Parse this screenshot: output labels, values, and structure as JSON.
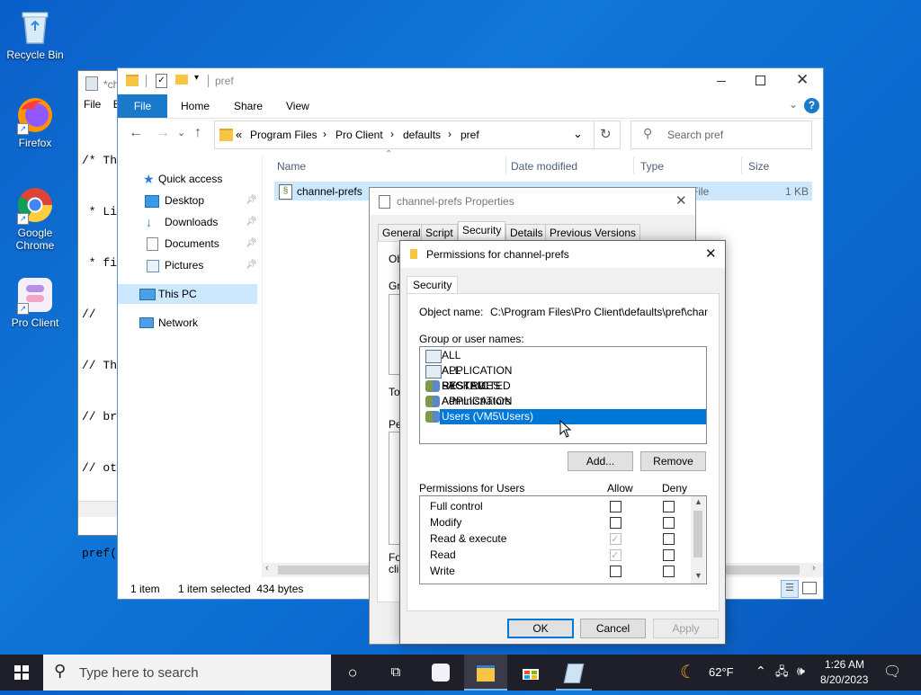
{
  "desktop": {
    "icons": [
      {
        "label": "Recycle Bin"
      },
      {
        "label": "Firefox"
      },
      {
        "label": "Google Chrome"
      },
      {
        "label": "Pro Client"
      }
    ]
  },
  "notepad": {
    "title_fragment": "*ch",
    "menu_file": "File",
    "menu_edit": "E",
    "code_lines": [
      "/* Th",
      " * Li",
      " * fi",
      "//",
      "// Th",
      "// br",
      "// ot",
      "",
      "pref("
    ]
  },
  "explorer": {
    "title": "pref",
    "ribbon": {
      "file": "File",
      "home": "Home",
      "share": "Share",
      "view": "View"
    },
    "address": {
      "sep": "«",
      "parts": [
        "Program Files",
        "Pro Client",
        "defaults",
        "pref"
      ]
    },
    "search_placeholder": "Search pref",
    "nav": {
      "quick_access": "Quick access",
      "desktop": "Desktop",
      "downloads": "Downloads",
      "documents": "Documents",
      "pictures": "Pictures",
      "this_pc": "This PC",
      "network": "Network"
    },
    "columns": {
      "name": "Name",
      "date": "Date modified",
      "type": "Type",
      "size": "Size"
    },
    "files": [
      {
        "name": "channel-prefs",
        "type_fragment": "File",
        "size": "1 KB"
      }
    ],
    "status": {
      "count": "1 item",
      "selected": "1 item selected  434 bytes"
    }
  },
  "properties": {
    "title": "channel-prefs Properties",
    "tabs": [
      "General",
      "Script",
      "Security",
      "Details",
      "Previous Versions"
    ],
    "fragments": {
      "ob": "Ob",
      "gr": "Gr",
      "to": "To",
      "pe": "Pe",
      "fo": "Fo",
      "cli": "clic"
    }
  },
  "permissions": {
    "title": "Permissions for channel-prefs",
    "tab": "Security",
    "object_label": "Object name:",
    "object_value": "C:\\Program Files\\Pro Client\\defaults\\pref\\channel-p",
    "group_label": "Group or user names:",
    "groups": [
      {
        "name": "ALL APPLICATION PACKAGES"
      },
      {
        "name": "ALL RESTRICTED APPLICATION PACKAGES"
      },
      {
        "name": "SYSTEM"
      },
      {
        "name": "Administrators (VM5\\Administrators)"
      },
      {
        "name": "Users (VM5\\Users)"
      }
    ],
    "add_button": "Add...",
    "remove_button": "Remove",
    "perm_for": "Permissions for Users",
    "allow_header": "Allow",
    "deny_header": "Deny",
    "perms": [
      {
        "name": "Full control",
        "allow": false,
        "allow_disabled": false,
        "deny": false
      },
      {
        "name": "Modify",
        "allow": false,
        "allow_disabled": false,
        "deny": false
      },
      {
        "name": "Read & execute",
        "allow": true,
        "allow_disabled": true,
        "deny": false
      },
      {
        "name": "Read",
        "allow": true,
        "allow_disabled": true,
        "deny": false
      },
      {
        "name": "Write",
        "allow": false,
        "allow_disabled": false,
        "deny": false
      }
    ],
    "ok": "OK",
    "cancel": "Cancel",
    "apply": "Apply"
  },
  "taskbar": {
    "search_placeholder": "Type here to search",
    "weather": "62°F",
    "time": "1:26 AM",
    "date": "8/20/2023"
  },
  "colors": {
    "accent": "#0078d7",
    "selection": "#0078d7",
    "file_tab": "#1979ca"
  }
}
